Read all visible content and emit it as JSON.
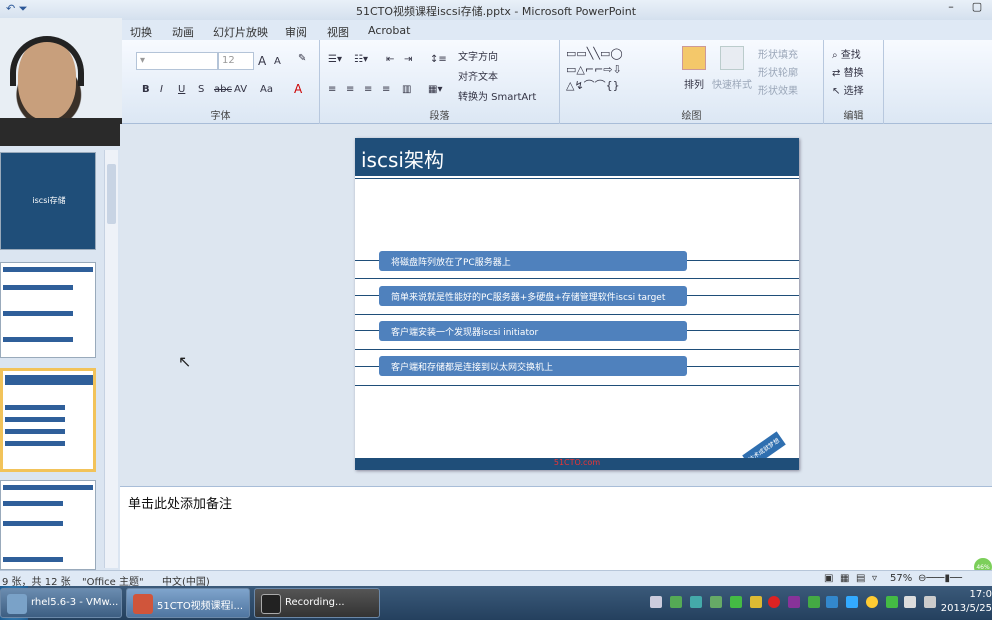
{
  "window": {
    "title": "51CTO视频课程iscsi存储.pptx - Microsoft PowerPoint",
    "qat_icon": "undo-icon"
  },
  "tabs": [
    "切换",
    "动画",
    "幻灯片放映",
    "审阅",
    "视图",
    "Acrobat"
  ],
  "ribbon": {
    "font": {
      "label": "字体",
      "size": "12",
      "bold": "B",
      "italic": "I",
      "underline": "U",
      "strike": "S",
      "abc": "abc",
      "case": "Aa",
      "color": "A",
      "grow": "A",
      "shrink": "A"
    },
    "paragraph": {
      "label": "段落",
      "text_direction": "文字方向",
      "align_text": "对齐文本",
      "smartart": "转换为 SmartArt"
    },
    "drawing": {
      "label": "绘图",
      "arrange": "排列",
      "quick_styles": "快速样式",
      "shape_fill": "形状填充",
      "shape_outline": "形状轮廓",
      "shape_effects": "形状效果"
    },
    "editing": {
      "label": "编辑",
      "find": "查找",
      "replace": "替换",
      "select": "选择"
    }
  },
  "thumbnails": {
    "first_title": "iscsi存储"
  },
  "slide": {
    "title": "iscsi架构",
    "bullets": [
      "将磁盘阵列放在了PC服务器上",
      "简单来说就是性能好的PC服务器+多硬盘+存储管理软件iscsi target",
      "客户端安装一个发现器iscsi initiator",
      "客户端和存储都是连接到以太网交换机上"
    ],
    "footer": "51CTO.com",
    "badge": "技术成就梦想"
  },
  "notes": {
    "placeholder": "单击此处添加备注"
  },
  "status": {
    "slide_count": "9 张，共 12 张",
    "theme": "\"Office 主题\"",
    "language": "中文(中国)",
    "zoom": "57%",
    "zoom_badge": "46%"
  },
  "taskbar": {
    "items": [
      "rhel5.6-3 - VMw...",
      "51CTO视频课程i...",
      "Recording..."
    ],
    "time": "17:0",
    "date": "2013/5/25"
  }
}
